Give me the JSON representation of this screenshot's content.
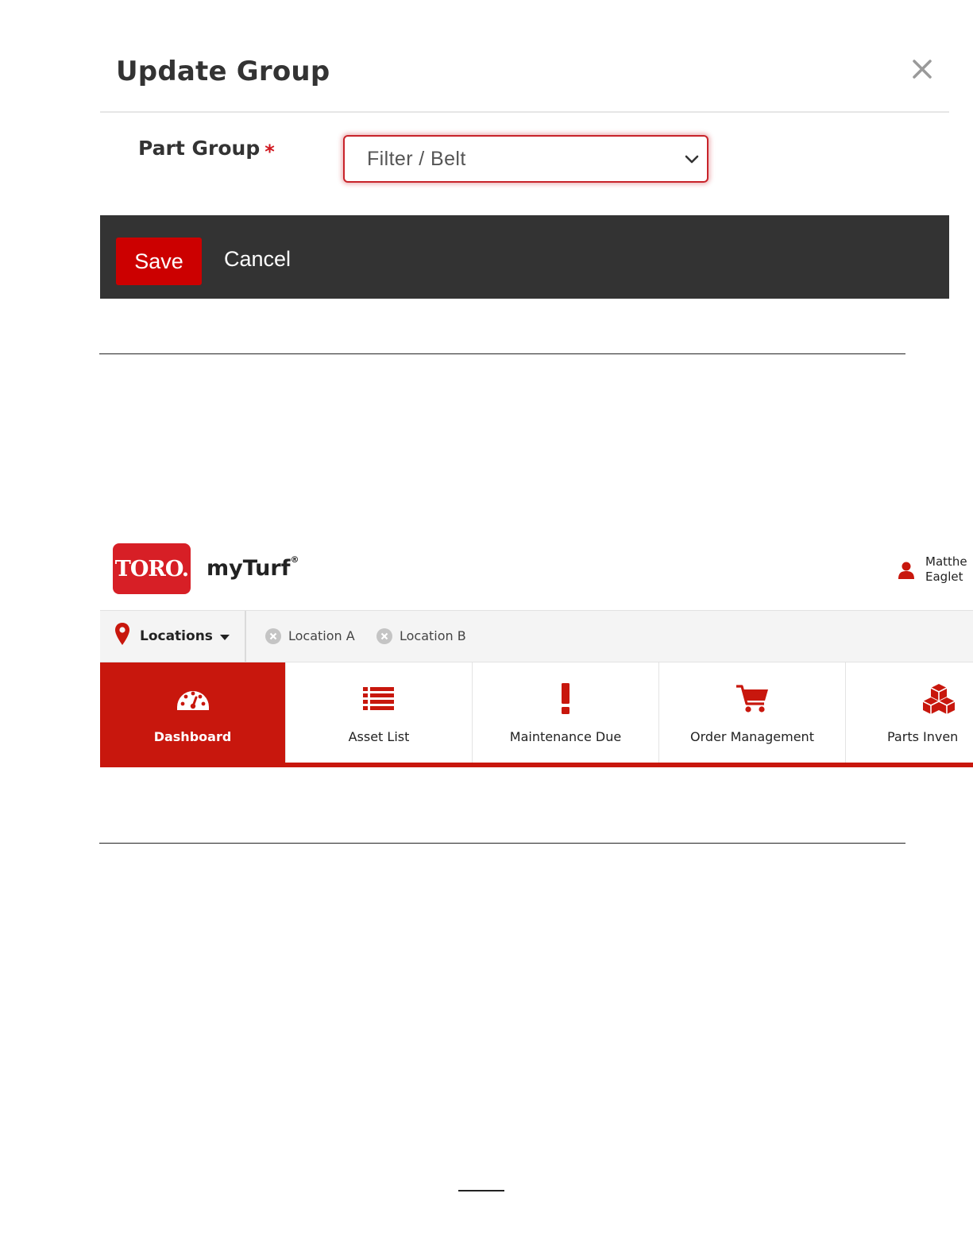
{
  "dialog": {
    "title": "Update Group",
    "field_label": "Part Group",
    "required_marker": "*",
    "select_value": "Filter / Belt",
    "save_label": "Save",
    "cancel_label": "Cancel"
  },
  "app": {
    "logo_text": "TORO.",
    "brand": "myTurf",
    "brand_mark": "®",
    "user": {
      "line1": "Matthe",
      "line2": "Eaglet"
    },
    "locations": {
      "dropdown_label": "Locations",
      "chips": [
        {
          "label": "Location A"
        },
        {
          "label": "Location B"
        }
      ]
    },
    "nav": [
      {
        "label": "Dashboard",
        "icon": "dashboard-icon",
        "active": true
      },
      {
        "label": "Asset List",
        "icon": "list-icon",
        "active": false
      },
      {
        "label": "Maintenance Due",
        "icon": "exclamation-icon",
        "active": false
      },
      {
        "label": "Order Management",
        "icon": "cart-icon",
        "active": false
      },
      {
        "label": "Parts Inven",
        "icon": "cubes-icon",
        "active": false
      }
    ]
  },
  "colors": {
    "accent": "#c8170d",
    "logo_red": "#d71f26",
    "save_button": "#cc0000",
    "footer_bar": "#333333"
  }
}
